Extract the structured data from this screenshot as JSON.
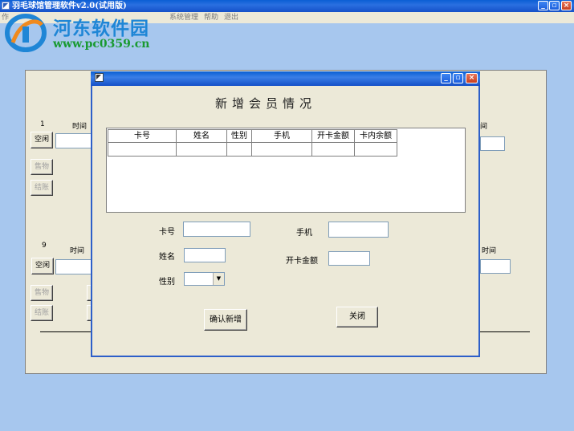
{
  "window": {
    "title": "羽毛球馆管理软件v2.0(试用版)"
  },
  "menu": {
    "items": [
      "作",
      "系统管理",
      "帮助",
      "退出"
    ]
  },
  "watermark": {
    "name": "河东软件园",
    "url": "www.pc0359.cn"
  },
  "courts": [
    {
      "number": "1",
      "time_label": "时间",
      "status_label": "空闲",
      "shop_label": "售物",
      "checkout_label": "结账"
    },
    {
      "number": "9",
      "time_label": "时间",
      "status_label": "空闲",
      "shop_label": "售物",
      "checkout_label": "结账"
    }
  ],
  "right_panel": {
    "time_label_top": "间",
    "time_label_bottom": "时间"
  },
  "dialog": {
    "heading": "新增会员情况",
    "table": {
      "columns": [
        "卡号",
        "姓名",
        "性别",
        "手机",
        "开卡金额",
        "卡内余额"
      ]
    },
    "form": {
      "card_no_label": "卡号",
      "name_label": "姓名",
      "gender_label": "性别",
      "phone_label": "手机",
      "open_amount_label": "开卡金额",
      "gender_value": ""
    },
    "confirm_label": "确认新增",
    "close_label": "关闭"
  },
  "colors": {
    "desktop": "#a7c7ee",
    "titlebar": "#0a5fd4",
    "face": "#ece9d8"
  },
  "icons": [
    "app-icon",
    "minimize-icon",
    "restore-icon",
    "close-icon",
    "dropdown-arrow-icon"
  ]
}
